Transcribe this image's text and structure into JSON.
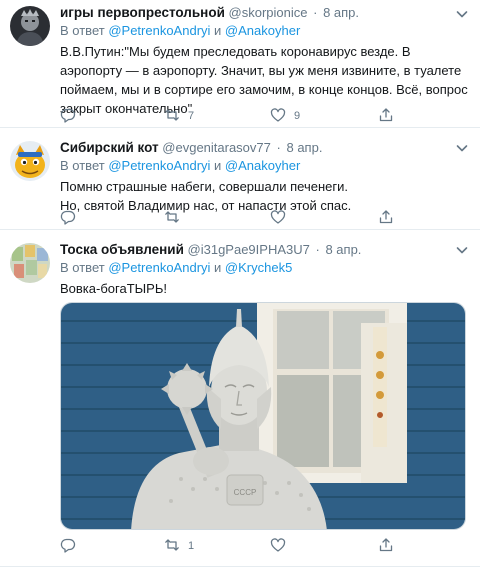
{
  "tweets": [
    {
      "name": "игры первопрестольной",
      "handle": "@skorpionice",
      "dot": "·",
      "date": "8 апр.",
      "reply_prefix": "В ответ",
      "mention1": "@PetrenkoAndryi",
      "conj": "и",
      "mention2": "@Anakoyher",
      "text": "В.В.Путин:\"Мы будем преследовать коронавирус везде. В аэропорту — в аэропорту. Значит, вы уж меня извините, в туалете поймаем, мы и в сортире его замочим, в конце концов. Всё, вопрос закрыт окончательно\"",
      "retweets": "7",
      "likes": "9"
    },
    {
      "name": "Сибирский кот",
      "handle": "@evgenitarasov77",
      "dot": "·",
      "date": "8 апр.",
      "reply_prefix": "В ответ",
      "mention1": "@PetrenkoAndryi",
      "conj": "и",
      "mention2": "@Anakoyher",
      "text_line1": "Помню страшные набеги, совершали печенеги.",
      "text_line2": "Но, святой Владимир нас, от напасти этой спас.",
      "retweets": "",
      "likes": ""
    },
    {
      "name": "Тоска объявлений",
      "handle": "@i31gPae9IPHA3U7",
      "dot": "·",
      "date": "8 апр.",
      "reply_prefix": "В ответ",
      "mention1": "@PetrenkoAndryi",
      "conj": "и",
      "mention2": "@Krychek5",
      "text": "Вовка-богаТЫРЬ!",
      "retweets": "1",
      "likes": ""
    }
  ],
  "icons": {
    "reply": "reply-icon",
    "retweet": "retweet-icon",
    "like": "like-icon",
    "share": "share-icon",
    "caret": "chevron-down-icon"
  },
  "colors": {
    "link": "#1b95e0",
    "secondary": "#657786",
    "text": "#14171a",
    "divider": "#e6ecf0"
  }
}
